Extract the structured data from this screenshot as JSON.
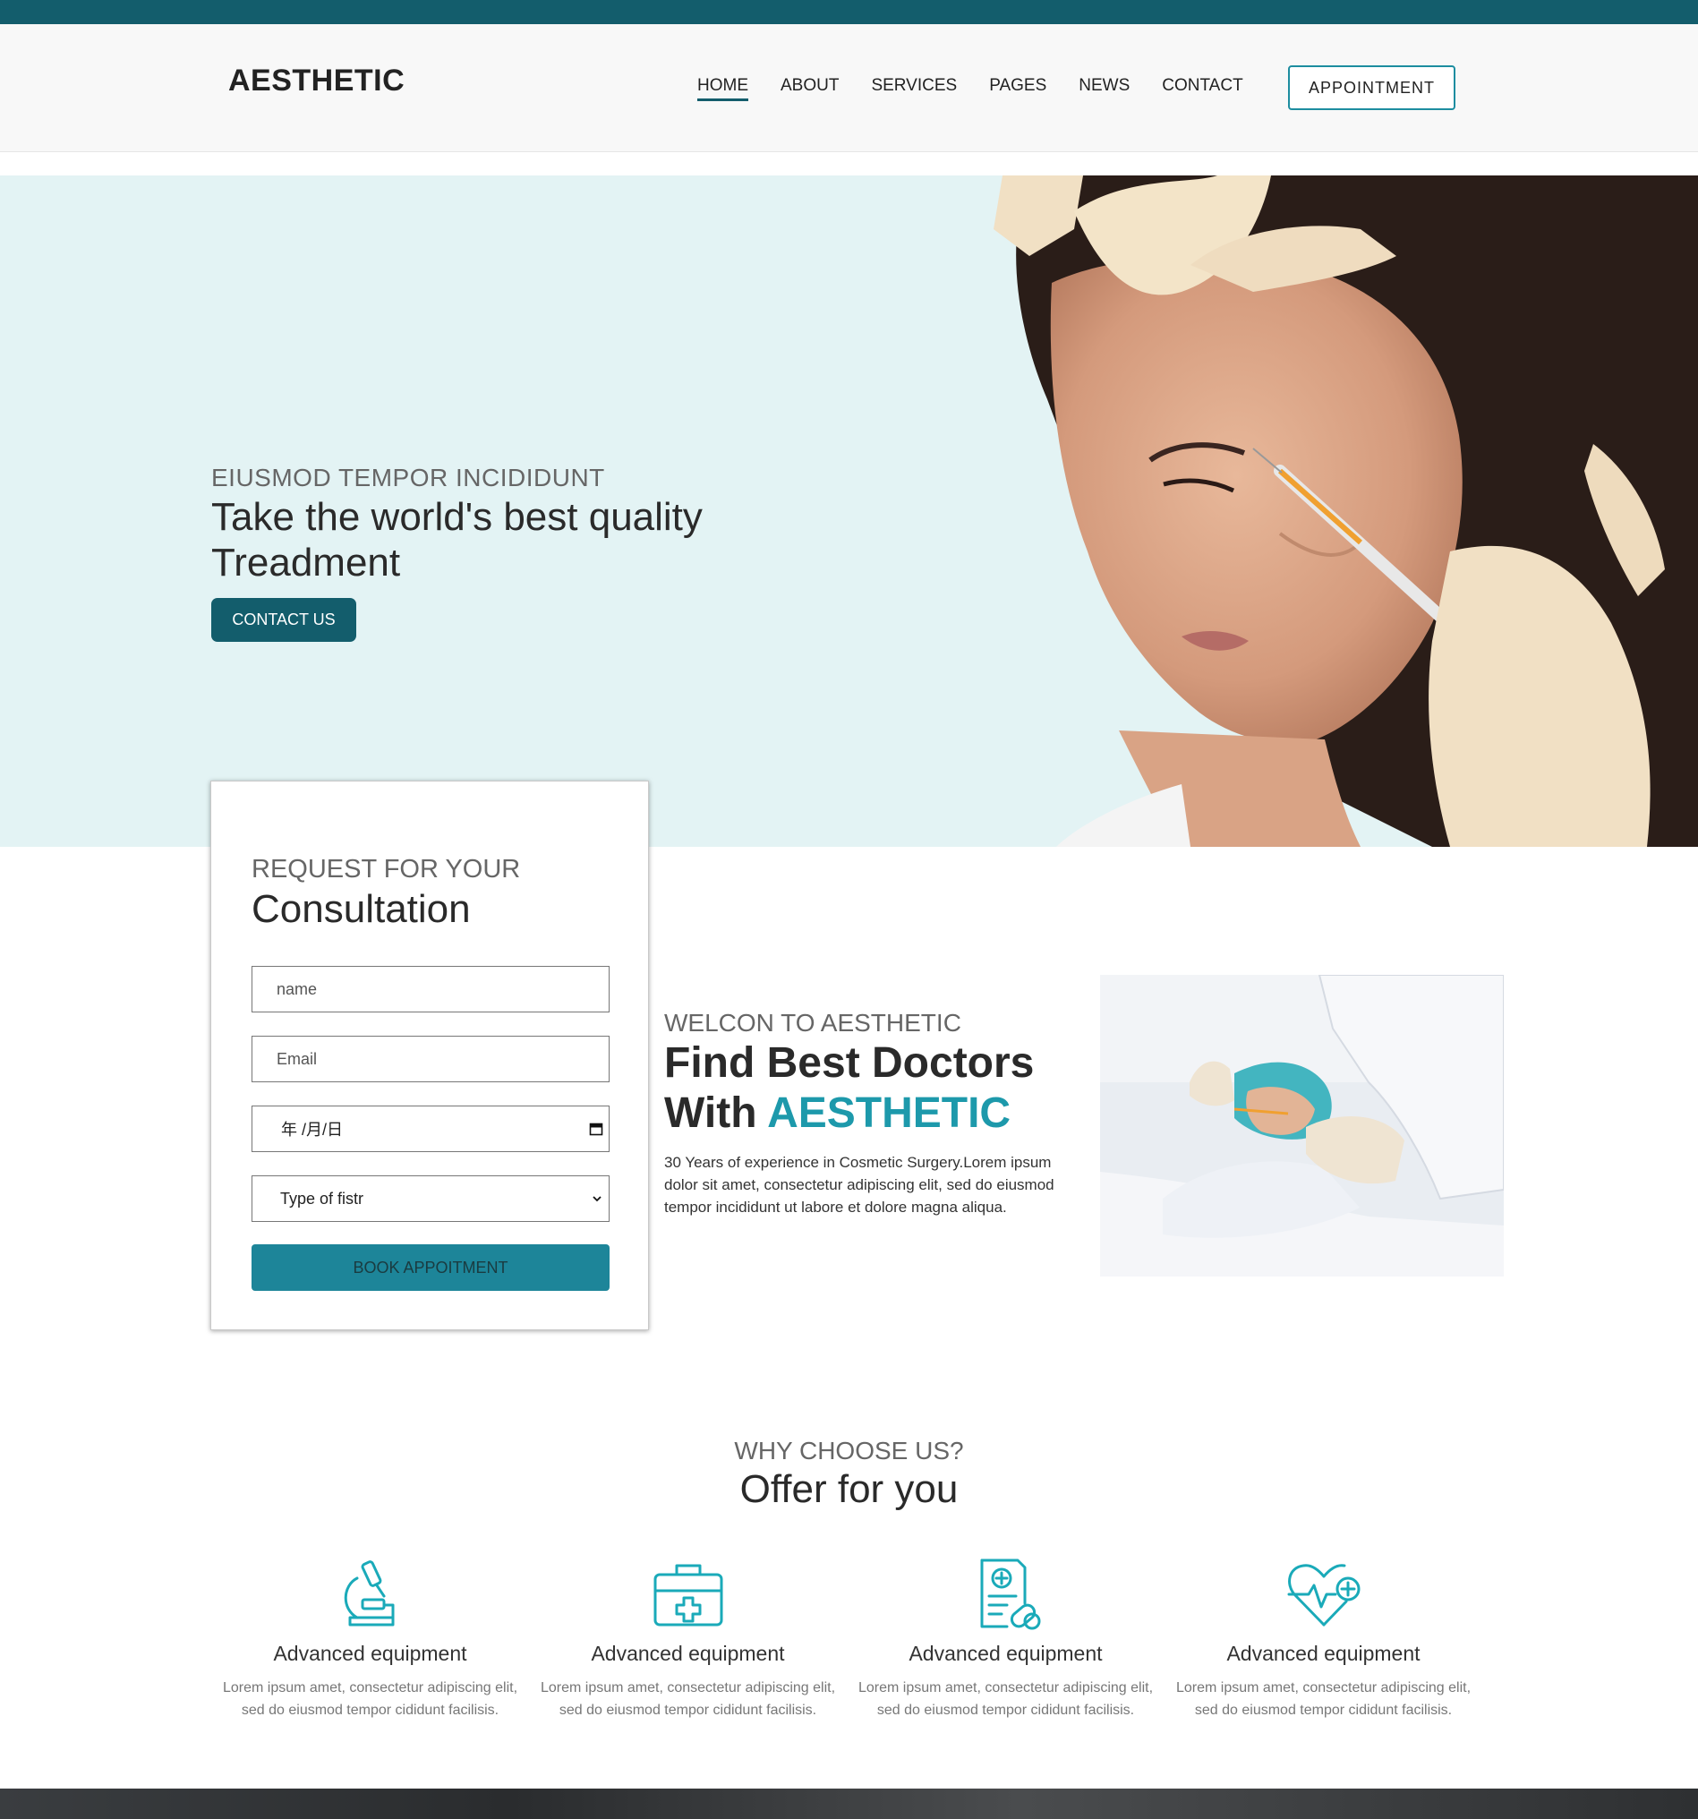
{
  "brand": {
    "logo": "AESTHETIC",
    "primary": "#135d6c",
    "accent": "#1d99ab",
    "hero_bg": "#e3f3f4"
  },
  "nav": {
    "items": [
      "HOME",
      "ABOUT",
      "SERVICES",
      "PAGES",
      "NEWS",
      "CONTACT"
    ],
    "active": "HOME",
    "appointment_label": "APPOINTMENT"
  },
  "hero": {
    "subtitle": "EIUSMOD TEMPOR INCIDIDUNT",
    "title": "Take the world's best quality Treadment",
    "cta_label": "CONTACT US",
    "image_icon": "woman-face-injection-photo"
  },
  "consultation": {
    "subtitle": "REQUEST FOR YOUR",
    "title": "Consultation",
    "name_placeholder": "name",
    "email_placeholder": "Email",
    "date_value": "年 /月/日",
    "select_value": "Type of fistr",
    "submit_label": "BOOK APPOITMENT"
  },
  "welcome": {
    "subtitle": "WELCON TO AESTHETIC",
    "title_line1": "Find Best Doctors",
    "title_line2_prefix": "With ",
    "title_line2_accent": "AESTHETIC",
    "body": "30 Years of experience in Cosmetic Surgery.Lorem ipsum dolor sit amet, consectetur adipiscing elit, sed do eiusmod tempor incididunt ut labore et dolore magna aliqua.",
    "image_icon": "doctor-treatment-photo"
  },
  "why": {
    "subtitle": "WHY CHOOSE US?",
    "title": "Offer for you",
    "features": [
      {
        "icon": "microscope-icon",
        "title": "Advanced equipment",
        "text": "Lorem ipsum amet, consectetur adipiscing elit, sed do eiusmod tempor cididunt facilisis."
      },
      {
        "icon": "medical-kit-icon",
        "title": "Advanced equipment",
        "text": "Lorem ipsum amet, consectetur adipiscing elit, sed do eiusmod tempor cididunt facilisis."
      },
      {
        "icon": "prescription-icon",
        "title": "Advanced equipment",
        "text": "Lorem ipsum amet, consectetur adipiscing elit, sed do eiusmod tempor cididunt facilisis."
      },
      {
        "icon": "heart-pulse-icon",
        "title": "Advanced equipment",
        "text": "Lorem ipsum amet, consectetur adipiscing elit, sed do eiusmod tempor cididunt facilisis."
      }
    ]
  }
}
